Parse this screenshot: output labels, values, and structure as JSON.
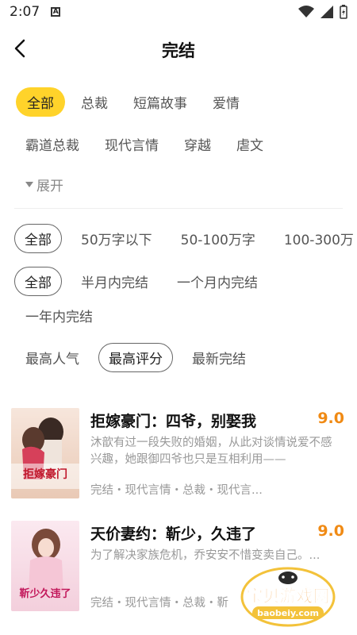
{
  "status_bar": {
    "time": "2:07",
    "notification_letter": "A"
  },
  "header": {
    "title": "完结"
  },
  "categories": {
    "row1": [
      "全部",
      "总裁",
      "短篇故事",
      "爱情"
    ],
    "row2": [
      "霸道总裁",
      "现代言情",
      "穿越",
      "虐文"
    ],
    "expand_label": "展开",
    "selected": "全部"
  },
  "filters": {
    "word_count": [
      "全部",
      "50万字以下",
      "50-100万字",
      "100-300万"
    ],
    "finish_time": [
      "全部",
      "半月内完结",
      "一个月内完结",
      "一年内完结"
    ],
    "sort": [
      "最高人气",
      "最高评分",
      "最新完结"
    ],
    "sort_selected": "最高评分"
  },
  "books": [
    {
      "title": "拒嫁豪门：四爷，别娶我",
      "score": "9.0",
      "description": "沐歆有过一段失败的婚姻，从此对谈情说爱不感兴趣，她跟御四爷也只是互相利用——",
      "tags": "完结・现代言情・总裁・现代言...",
      "cover_text": "拒嫁豪门"
    },
    {
      "title": "天价妻约：靳少，久违了",
      "score": "9.0",
      "description": "为了解决家族危机，乔安安不惜变卖自己。...",
      "tags": "完结・现代言情・总裁・靳",
      "cover_text": "靳少久违了"
    }
  ],
  "watermark": {
    "text": "宝贝游戏网",
    "url": "baobeiy.com"
  },
  "colors": {
    "accent_yellow": "#ffd32a",
    "score_orange": "#f08a14"
  }
}
